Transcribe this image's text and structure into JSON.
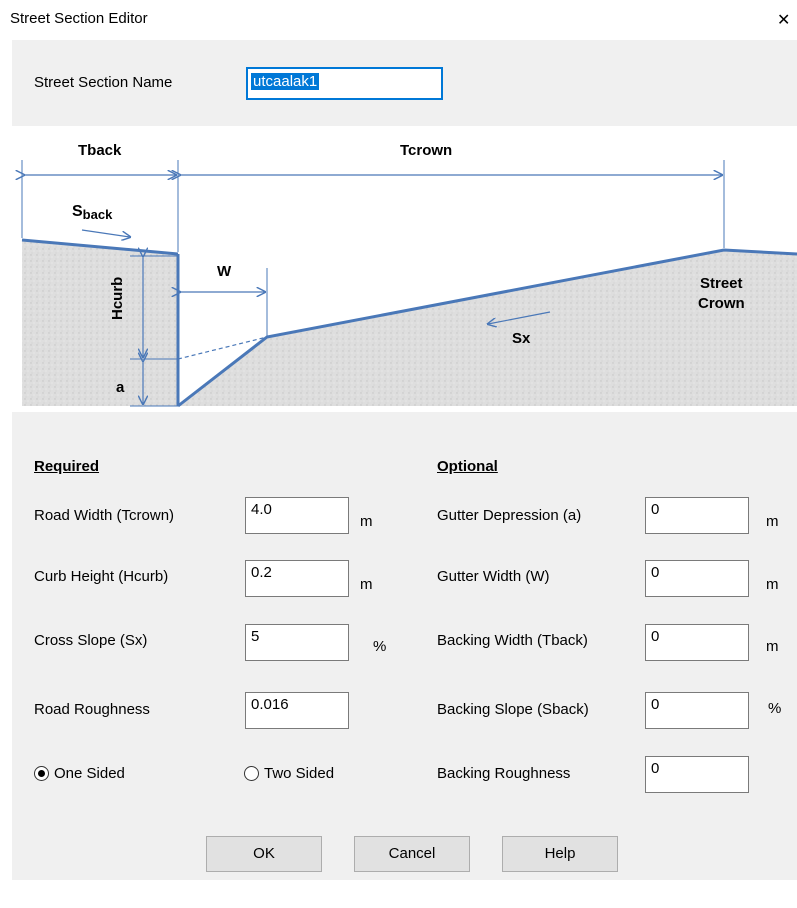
{
  "window": {
    "title": "Street Section Editor",
    "close_glyph": "✕"
  },
  "name_row": {
    "label": "Street Section Name",
    "value": "utcaalak1"
  },
  "diagram": {
    "tback": "Tback",
    "tcrown": "Tcrown",
    "sback_s": "S",
    "sback_sub": "back",
    "w": "W",
    "hcurb": "Hcurb",
    "a": "a",
    "sx": "Sx",
    "street": "Street",
    "crown": "Crown"
  },
  "required": {
    "heading": "Required",
    "road_width": {
      "label": "Road Width (Tcrown)",
      "value": "4.0",
      "unit": "m"
    },
    "curb_height": {
      "label": "Curb Height (Hcurb)",
      "value": "0.2",
      "unit": "m"
    },
    "cross_slope": {
      "label": "Cross Slope (Sx)",
      "value": "5",
      "unit": "%"
    },
    "road_roughness": {
      "label": "Road Roughness",
      "value": "0.016"
    },
    "one_sided": "One Sided",
    "two_sided": "Two Sided"
  },
  "optional": {
    "heading": "Optional",
    "gutter_depression": {
      "label": "Gutter Depression (a)",
      "value": "0",
      "unit": "m"
    },
    "gutter_width": {
      "label": "Gutter Width (W)",
      "value": "0",
      "unit": "m"
    },
    "backing_width": {
      "label": "Backing Width (Tback)",
      "value": "0",
      "unit": "m"
    },
    "backing_slope": {
      "label": "Backing Slope (Sback)",
      "value": "0",
      "unit": "%"
    },
    "backing_roughness": {
      "label": "Backing Roughness",
      "value": "0"
    }
  },
  "buttons": {
    "ok": "OK",
    "cancel": "Cancel",
    "help": "Help"
  },
  "colors": {
    "accent": "#0078d7",
    "line": "#4a78b8",
    "panel": "#f0f0f0"
  }
}
